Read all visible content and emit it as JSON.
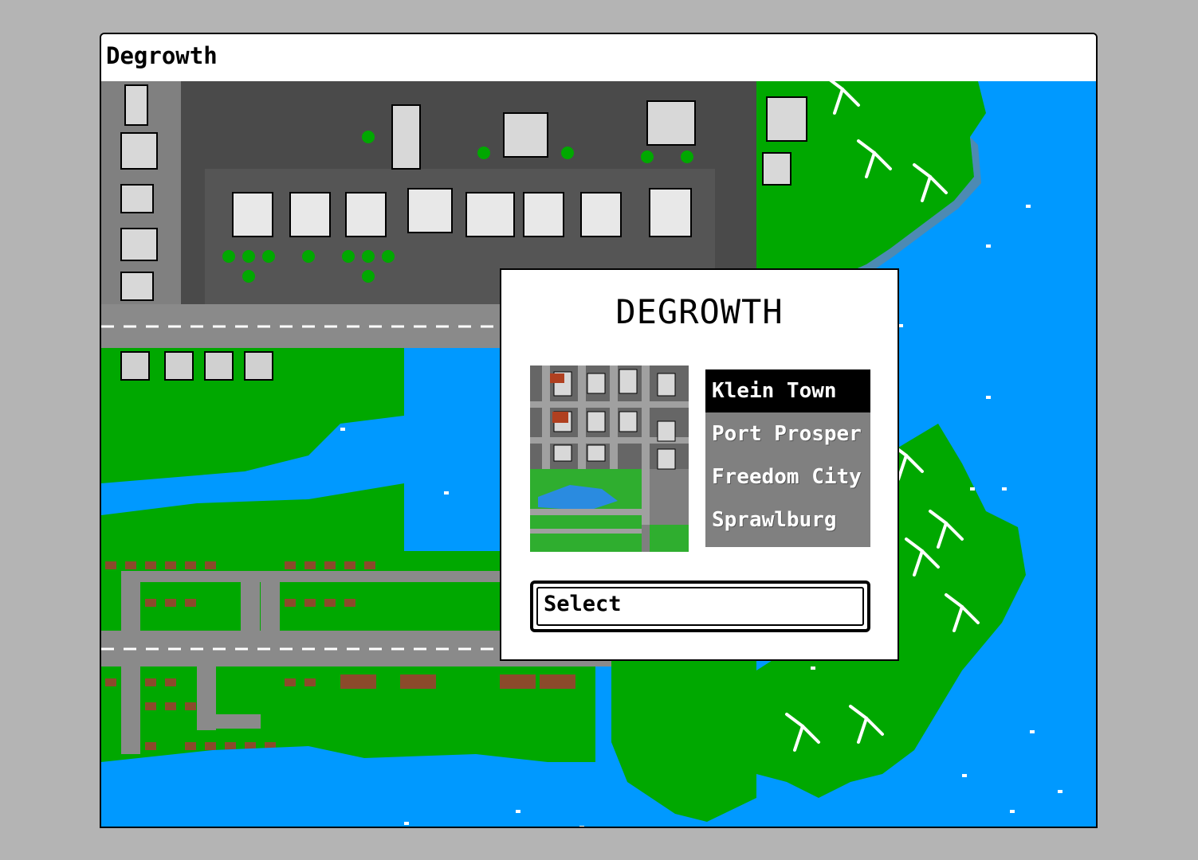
{
  "window": {
    "title": "Degrowth"
  },
  "dialog": {
    "title": "DEGROWTH",
    "cities": [
      {
        "label": "Klein Town",
        "selected": true
      },
      {
        "label": "Port Prosper",
        "selected": false
      },
      {
        "label": "Freedom City",
        "selected": false
      },
      {
        "label": "Sprawlburg",
        "selected": false
      }
    ],
    "select_label": "Select"
  },
  "colors": {
    "water": "#0099ff",
    "grass": "#00a800",
    "road": "#808080",
    "asphalt": "#555555",
    "selected_item": "#000000",
    "list_bg": "#808080"
  }
}
